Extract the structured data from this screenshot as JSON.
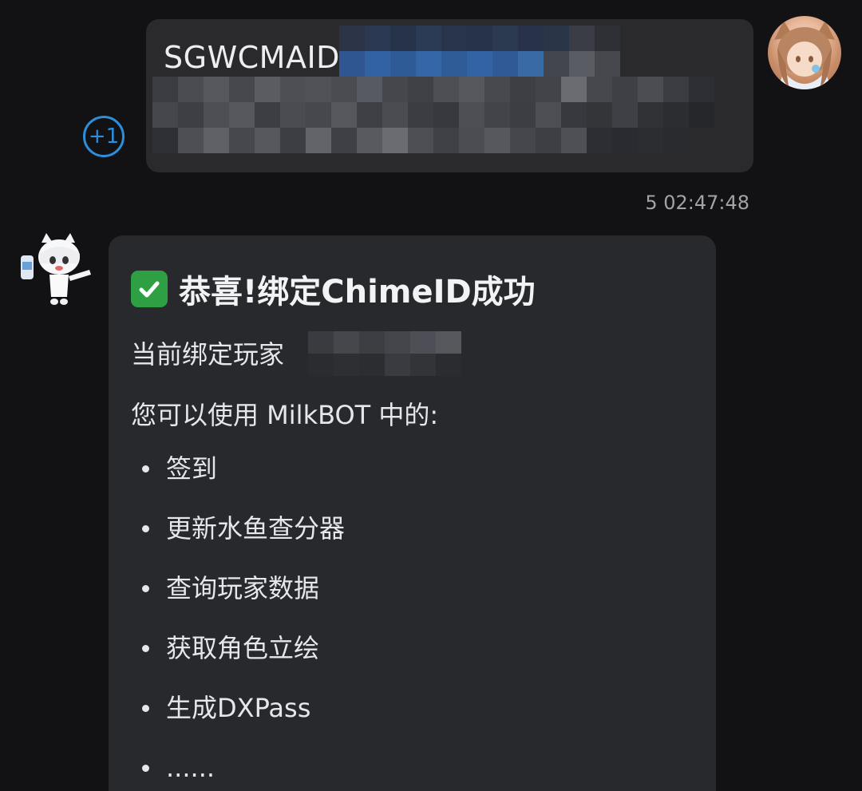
{
  "outgoing": {
    "text_prefix": "SGWCMAID",
    "reaction_badge": "+1",
    "timestamp": "5 02:47:48"
  },
  "incoming": {
    "title": "恭喜!绑定ChimeID成功",
    "title_icon": "check-mark-button-icon",
    "current_player_label": "当前绑定玩家",
    "usage_intro": "您可以使用 MilkBOT 中的:",
    "features": [
      "签到",
      "更新水鱼查分器",
      "查询玩家数据",
      "获取角色立绘",
      "生成DXPass",
      "......"
    ]
  },
  "colors": {
    "background": "#121214",
    "bubble": "#2a2a2d",
    "accent_blue": "#2b8fdb",
    "check_green": "#2ea043"
  }
}
